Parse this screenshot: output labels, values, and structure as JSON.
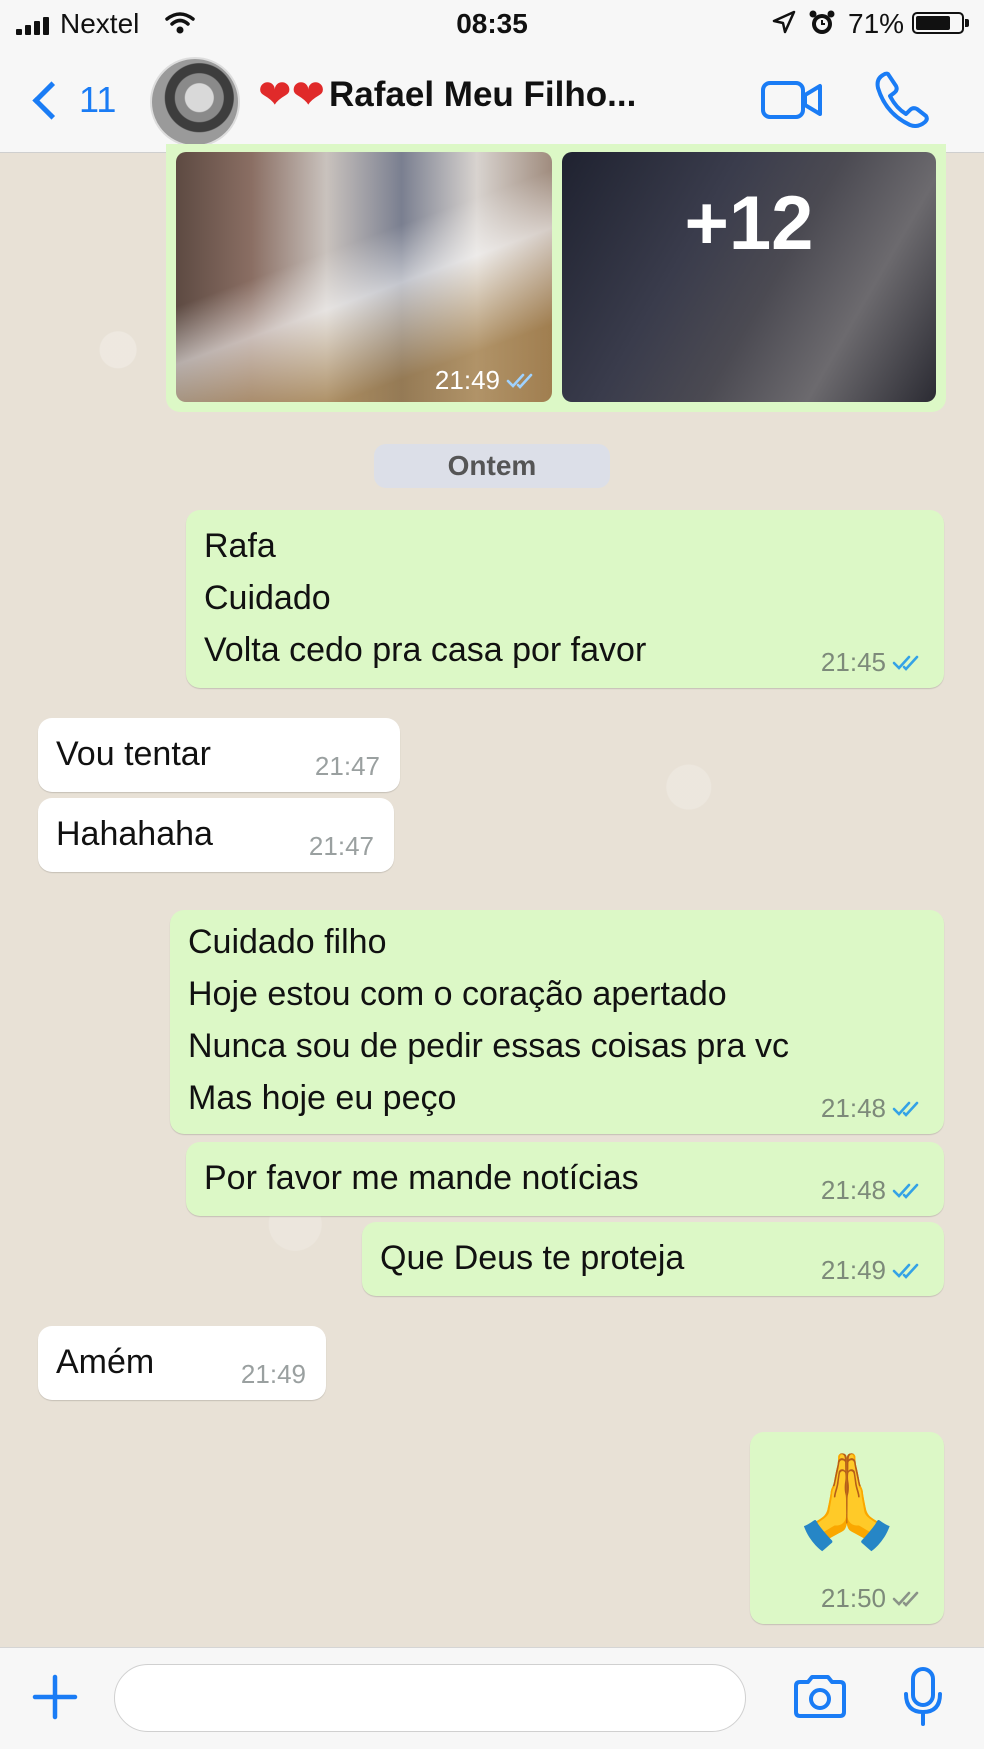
{
  "status_bar": {
    "carrier": "Nextel",
    "time": "08:35",
    "battery": "71%"
  },
  "header": {
    "back_count": "11",
    "contact_name": "Rafael Meu Filho...",
    "hearts": "❤❤"
  },
  "media": {
    "more_count": "+12",
    "time": "21:49"
  },
  "date_separator": "Ontem",
  "messages": [
    {
      "direction": "out",
      "lines": [
        "Rafa",
        "Cuidado",
        "Volta cedo pra casa por favor"
      ],
      "time": "21:45"
    },
    {
      "direction": "in",
      "lines": [
        "Vou tentar"
      ],
      "time": "21:47"
    },
    {
      "direction": "in",
      "lines": [
        "Hahahaha"
      ],
      "time": "21:47"
    },
    {
      "direction": "out",
      "lines": [
        "Cuidado filho",
        "Hoje estou com o coração apertado",
        "Nunca sou de pedir essas coisas pra vc",
        "Mas hoje eu peço"
      ],
      "time": "21:48"
    },
    {
      "direction": "out",
      "lines": [
        "Por favor me mande notícias"
      ],
      "time": "21:48"
    },
    {
      "direction": "out",
      "lines": [
        "Que Deus te proteja"
      ],
      "time": "21:49"
    },
    {
      "direction": "in",
      "lines": [
        "Amém"
      ],
      "time": "21:49"
    },
    {
      "direction": "out",
      "lines": [
        "🙏"
      ],
      "time": "21:50"
    }
  ],
  "composer": {
    "placeholder": ""
  },
  "colors": {
    "accent": "#1a7cf5",
    "outgoing_bubble": "#dcf8c6",
    "incoming_bubble": "#ffffff",
    "read_ticks": "#34a2e6"
  }
}
